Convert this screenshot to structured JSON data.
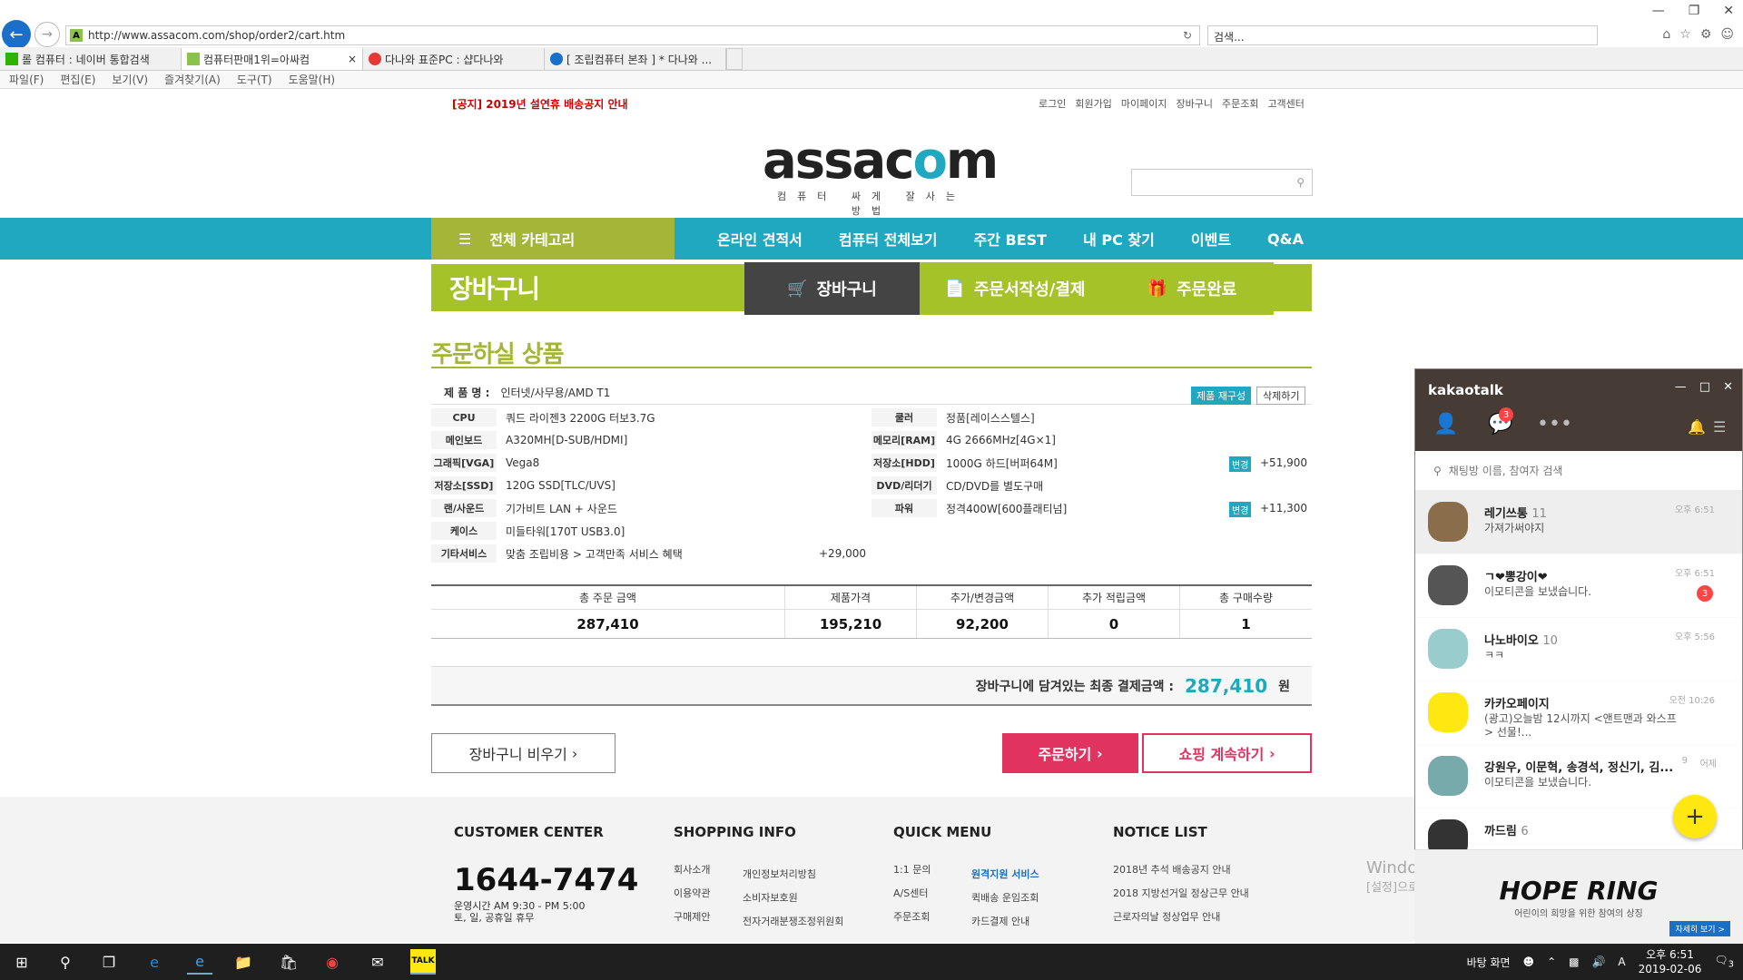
{
  "browser": {
    "url": "http://www.assacom.com/shop/order2/cart.htm",
    "search_placeholder": "검색...",
    "tabs": [
      {
        "label": "롤 컴퓨터 : 네이버 통합검색",
        "color": "#2db400"
      },
      {
        "label": "컴퓨터판매1위=아싸컴",
        "color": "#8bc34a"
      },
      {
        "label": "다나와 표준PC : 샵다나와",
        "color": "#e53935"
      },
      {
        "label": "[ 조립컴퓨터 본좌 ] * 다나와 ...",
        "color": "#1a6fc9"
      }
    ],
    "menu": [
      "파일(F)",
      "편집(E)",
      "보기(V)",
      "즐겨찾기(A)",
      "도구(T)",
      "도움말(H)"
    ]
  },
  "site": {
    "notice": "[공지] 2019년 설연휴 배송공지 안내",
    "toplinks": [
      "로그인",
      "회원가입",
      "마이페이지",
      "장바구니",
      "주문조회",
      "고객센터"
    ],
    "logo_main_a": "assac",
    "logo_main_o": "o",
    "logo_main_b": "m",
    "logo_sub": "컴퓨터 싸게 잘사는 방법",
    "category_btn": "전체 카테고리",
    "gnb": [
      "온라인 견적서",
      "컴퓨터 전체보기",
      "주간 BEST",
      "내 PC 찾기",
      "이벤트",
      "Q&A"
    ],
    "cart_title": "장바구니",
    "steps": [
      "장바구니",
      "주문서작성/결제",
      "주문완료"
    ],
    "order_title": "주문하실 상품",
    "product_label": "제 품 명 :",
    "product_name": "인터넷/사무용/AMD T1",
    "btn_reconfig": "제품 재구성",
    "btn_delete": "삭제하기",
    "specs_left": [
      {
        "k": "CPU",
        "v": "쿼드 라이젠3 2200G 터보3.7G"
      },
      {
        "k": "메인보드",
        "v": "A320MH[D-SUB/HDMI]"
      },
      {
        "k": "그래픽[VGA]",
        "v": "Vega8"
      },
      {
        "k": "저장소[SSD]",
        "v": "120G SSD[TLC/UVS]"
      },
      {
        "k": "랜/사운드",
        "v": "기가비트 LAN + 사운드"
      },
      {
        "k": "케이스",
        "v": "미들타워[170T USB3.0]"
      },
      {
        "k": "기타서비스",
        "v": "맞춤 조립비용 > 고객만족 서비스 혜택"
      }
    ],
    "specs_right": [
      {
        "k": "쿨러",
        "v": "정품[레이스스텔스]"
      },
      {
        "k": "메모리[RAM]",
        "v": "4G 2666MHz[4G×1]"
      },
      {
        "k": "저장소[HDD]",
        "v": "1000G 하드[버퍼64M]"
      },
      {
        "k": "DVD/리더기",
        "v": "CD/DVD를 별도구매"
      },
      {
        "k": "파워",
        "v": "정격400W[600플래티넘]"
      }
    ],
    "change_label": "변경",
    "hdd_add": "+51,900",
    "power_add": "+11,300",
    "service_add": "+29,000",
    "summary_heads": [
      "총 주문 금액",
      "제품가격",
      "추가/변경금액",
      "추가 적립금액",
      "총 구매수량"
    ],
    "summary_vals": [
      "287,410",
      "195,210",
      "92,200",
      "0",
      "1"
    ],
    "final_label": "장바구니에 담겨있는 최종 결제금액 :",
    "final_amount": "287,410",
    "final_unit": "원",
    "btn_empty": "장바구니 비우기",
    "btn_order": "주문하기",
    "btn_continue": "쇼핑 계속하기",
    "footer": {
      "cc_title": "CUSTOMER CENTER",
      "phone": "1644-7474",
      "hours1": "운영시간 AM 9:30 - PM 5:00",
      "hours2": "토, 일, 공휴일 휴무",
      "shop_title": "SHOPPING INFO",
      "shop_a": [
        "회사소개",
        "이용약관",
        "구매제안"
      ],
      "shop_b": [
        "개인정보처리방침",
        "소비자보호원",
        "전자거래분쟁조정위원회"
      ],
      "quick_title": "QUICK MENU",
      "quick_a": [
        "1:1 문의",
        "A/S센터",
        "주문조회"
      ],
      "quick_b": [
        "원격지원 서비스",
        "퀵배송 운임조회",
        "카드결제 안내"
      ],
      "notice_title": "NOTICE LIST",
      "notices": [
        "2018년 추석 배송공지 안내",
        "2018 지방선거일 정상근무 안내",
        "근로자의날 정상업무 안내"
      ]
    }
  },
  "kakao": {
    "title": "kakaotalk",
    "badge": "3",
    "search_placeholder": "채팅방 이름, 참여자 검색",
    "chats": [
      {
        "name": "레기쓰통",
        "count": "11",
        "msg": "가져가써야지",
        "time": "오후 6:51",
        "badge": ""
      },
      {
        "name": "ㄱ❤뽕강이❤",
        "count": "",
        "msg": "이모티콘을 보냈습니다.",
        "time": "오후 6:51",
        "badge": "3"
      },
      {
        "name": "나노바이오",
        "count": "10",
        "msg": "ㅋㅋ",
        "time": "오후 5:56",
        "badge": ""
      },
      {
        "name": "카카오페이지",
        "count": "",
        "msg": "(광고)오늘밤 12시까지 <앤트맨과 와스프> 선물!...",
        "time": "오전 10:26",
        "badge": ""
      },
      {
        "name": "강원우, 이문혁, 송경석, 정신기, 김...",
        "count": "9",
        "msg": "이모티콘을 보냈습니다.",
        "time": "어제",
        "badge": ""
      },
      {
        "name": "까드림",
        "count": "6",
        "msg": "",
        "time": "",
        "badge": ""
      }
    ],
    "ad_title": "HOPE RING",
    "ad_sub": "어린이의 희망을 위한 참여의 상징",
    "ad_btn": "자세히 보기 >"
  },
  "watermark": {
    "l1": "Windows 정품 인증",
    "l2": "[설정]으로 이동하여 Windows를 정품 인증합니다."
  },
  "taskbar": {
    "desktop": "바탕 화면",
    "ime": "A",
    "time": "오후 6:51",
    "date": "2019-02-06",
    "notif": "3"
  }
}
